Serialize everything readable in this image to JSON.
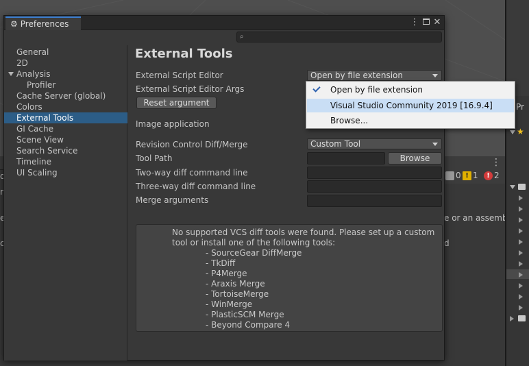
{
  "window": {
    "title": "Preferences",
    "search_placeholder": ""
  },
  "sidebar": {
    "items": [
      {
        "label": "General"
      },
      {
        "label": "2D"
      },
      {
        "label": "Analysis"
      },
      {
        "label": "Profiler"
      },
      {
        "label": "Cache Server (global)"
      },
      {
        "label": "Colors"
      },
      {
        "label": "External Tools",
        "selected": true
      },
      {
        "label": "GI Cache"
      },
      {
        "label": "Scene View"
      },
      {
        "label": "Search Service"
      },
      {
        "label": "Timeline"
      },
      {
        "label": "UI Scaling"
      }
    ]
  },
  "main": {
    "title": "External Tools",
    "script_editor_label": "External Script Editor",
    "script_editor_value": "Open by file extension",
    "script_editor_args_label": "External Script Editor Args",
    "reset_argument_label": "Reset argument",
    "image_application_label": "Image application",
    "revision_diff_label": "Revision Control Diff/Merge",
    "revision_diff_value": "Custom Tool",
    "tool_path_label": "Tool Path",
    "browse_label": "Browse",
    "two_way_label": "Two-way diff command line",
    "three_way_label": "Three-way diff command line",
    "merge_args_label": "Merge arguments",
    "info_text": "No supported VCS diff tools were found. Please set up a custom tool or install one of the following tools:",
    "tools": [
      "- SourceGear DiffMerge",
      "- TkDiff",
      "- P4Merge",
      "- Araxis Merge",
      "- TortoiseMerge",
      "- WinMerge",
      "- PlasticSCM Merge",
      "- Beyond Compare 4"
    ]
  },
  "popup_menu": {
    "items": [
      {
        "label": "Open by file extension",
        "checked": true
      },
      {
        "label": "Visual Studio Community 2019 [16.9.4]",
        "highlighted": true
      },
      {
        "label": "Browse..."
      }
    ]
  },
  "background": {
    "console_counts": {
      "info": "0",
      "warnings": "1",
      "errors": "2"
    },
    "fragment_right": "e or an assembly",
    "fragment_d": "d",
    "fragment_left_1": "di",
    "fragment_left_2": "m",
    "fragment_left_3": "e.",
    "fragment_left_4": "ck",
    "project_label": "Pr"
  },
  "colors": {
    "selection": "#2c5d87",
    "menu_highlight": "#c9def5",
    "tab_accent": "#3d7fd1",
    "warning": "#e0b000",
    "error": "#d23b3b"
  }
}
